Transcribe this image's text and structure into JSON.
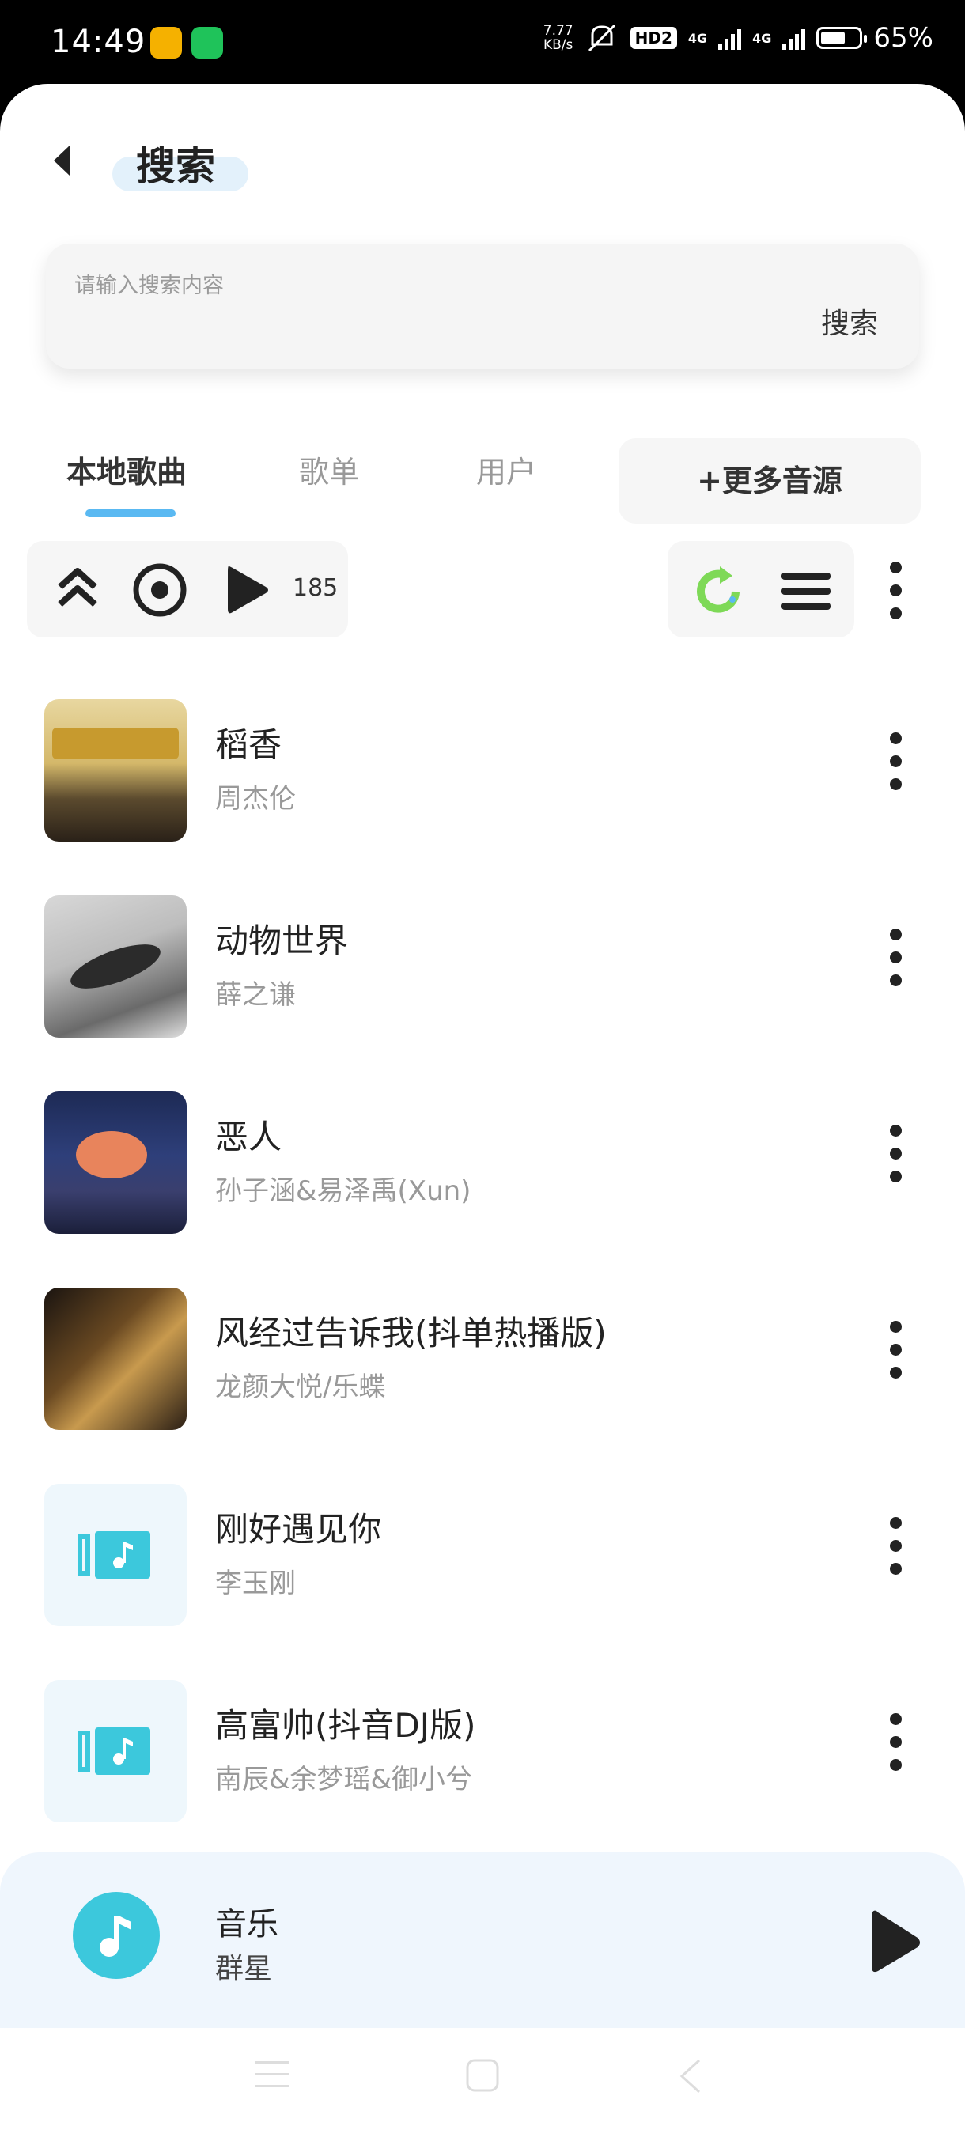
{
  "status_bar": {
    "time": "14:49",
    "net_speed_value": "7.77",
    "net_speed_unit": "KB/s",
    "hd_badge": "HD2",
    "net1": "4G",
    "net2": "4G",
    "battery_percent": "65%"
  },
  "header": {
    "title": "搜索"
  },
  "search": {
    "placeholder": "请输入搜索内容",
    "button": "搜索"
  },
  "tabs": [
    {
      "label": "本地歌曲",
      "active": true
    },
    {
      "label": "歌单",
      "active": false
    },
    {
      "label": "用户",
      "active": false
    }
  ],
  "more_sources": "+更多音源",
  "toolbar": {
    "count": "185"
  },
  "songs": [
    {
      "title": "稻香",
      "artist": "周杰伦",
      "cover": "album-compilation"
    },
    {
      "title": "动物世界",
      "artist": "薛之谦",
      "cover": "album-gray-photo"
    },
    {
      "title": "恶人",
      "artist": "孙子涵&易泽禹(Xun)",
      "cover": "album-night-sky"
    },
    {
      "title": "风经过告诉我(抖单热播版)",
      "artist": "龙颜大悦/乐蝶",
      "cover": "album-portrait"
    },
    {
      "title": "刚好遇见你",
      "artist": "李玉刚",
      "cover": "music-file-icon"
    },
    {
      "title": "高富帅(抖音DJ版)",
      "artist": "南辰&余梦瑶&御小兮",
      "cover": "music-file-icon"
    }
  ],
  "player": {
    "title": "音乐",
    "artist": "群星"
  },
  "colors": {
    "accent": "#5ab9f2",
    "teal": "#3cc8dc",
    "refresh": "#7ed957"
  }
}
